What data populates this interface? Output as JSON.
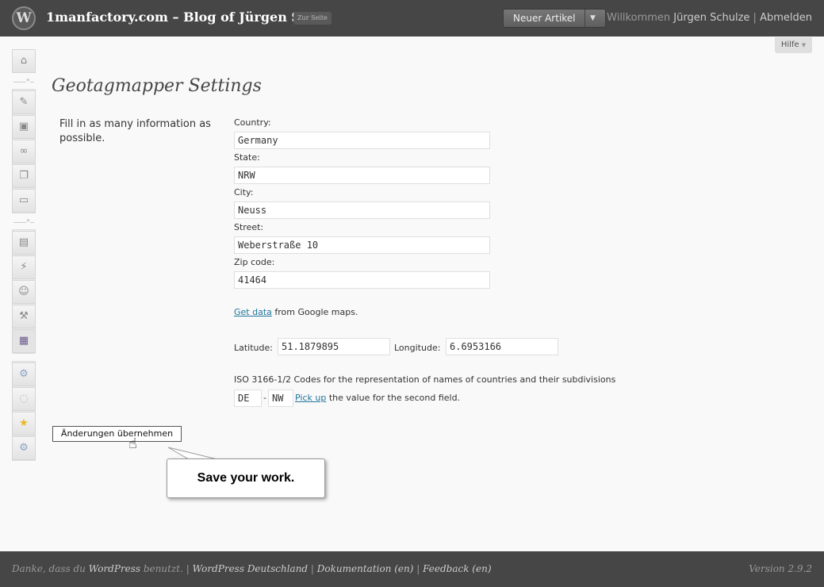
{
  "header": {
    "logo_glyph": "W",
    "site_title": "1manfactory.com – Blog of Jürgen S...",
    "visit_site": "Zur Seite",
    "new_post": "Neuer Artikel",
    "new_post_arrow": "▼",
    "welcome_text": "Willkommen",
    "user_name": "Jürgen Schulze",
    "separator": "|",
    "logout": "Abmelden",
    "help": "Hilfe",
    "help_arrow": "▼"
  },
  "sidebar": {
    "icons": [
      {
        "name": "dashboard-icon",
        "glyph": "⌂"
      },
      {
        "name": "posts-icon",
        "glyph": "✎"
      },
      {
        "name": "media-icon",
        "glyph": "▣"
      },
      {
        "name": "links-icon",
        "glyph": "∞"
      },
      {
        "name": "pages-icon",
        "glyph": "❐"
      },
      {
        "name": "comments-icon",
        "glyph": "▭"
      },
      {
        "name": "appearance-icon",
        "glyph": "▤"
      },
      {
        "name": "plugins-icon",
        "glyph": "⚡"
      },
      {
        "name": "users-icon",
        "glyph": "☺"
      },
      {
        "name": "tools-icon",
        "glyph": "⚒"
      },
      {
        "name": "settings-icon",
        "glyph": "▦"
      },
      {
        "name": "plugin-gear-icon",
        "glyph": "⚙"
      },
      {
        "name": "database-icon",
        "glyph": "◌"
      },
      {
        "name": "star-icon",
        "glyph": "★"
      },
      {
        "name": "plugin-gear-2-icon",
        "glyph": "⚙"
      }
    ],
    "separator_glyph": "»"
  },
  "main": {
    "title": "Geotagmapper Settings",
    "intro": "Fill in as many information as possible.",
    "fields": [
      {
        "label": "Country:",
        "value": "Germany"
      },
      {
        "label": "State:",
        "value": "NRW"
      },
      {
        "label": "City:",
        "value": "Neuss"
      },
      {
        "label": "Street:",
        "value": "Weberstraße 10"
      },
      {
        "label": "Zip code:",
        "value": "41464"
      }
    ],
    "get_data_link": "Get data",
    "get_data_rest": " from Google maps.",
    "latitude_label": "Latitude:",
    "latitude_value": "51.1879895",
    "longitude_label": "Longitude:",
    "longitude_value": "6.6953166",
    "iso_description": "ISO 3166-1/2 Codes for the representation of names of countries and their subdivisions",
    "iso_code_1": "DE",
    "iso_dash": "-",
    "iso_code_2": "NW",
    "pick_up_link": "Pick up",
    "pick_up_rest": " the value for the second field.",
    "save_button": "Änderungen übernehmen",
    "cursor_glyph": "☝"
  },
  "callout": {
    "text": "Save your work."
  },
  "footer": {
    "thanks_prefix": "Danke, dass du ",
    "wordpress": "WordPress",
    "thanks_suffix": " benutzt.",
    "sep": " | ",
    "wp_de": "WordPress Deutschland",
    "docs": "Dokumentation (en)",
    "feedback": "Feedback (en)",
    "version": "Version 2.9.2"
  }
}
